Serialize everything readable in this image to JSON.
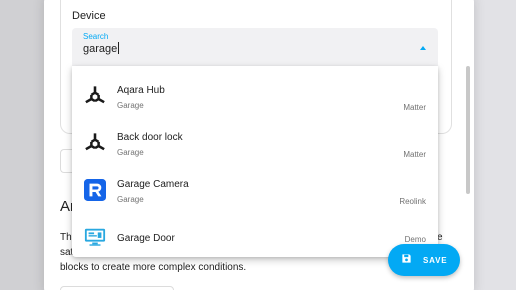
{
  "dialog": {
    "device_label": "Device",
    "search": {
      "label": "Search",
      "value": "garage"
    },
    "area_heading_start": "Ar",
    "area_heading_end": ")",
    "description": {
      "fragment_1": "Th",
      "fragment_2": "sat",
      "end_fragment": "e",
      "line_3": "blocks to create more complex conditions."
    },
    "save_label": "SAVE"
  },
  "menu": {
    "items": [
      {
        "name": "Aqara Hub",
        "area": "Garage",
        "source": "Matter",
        "icon": "matter-icon"
      },
      {
        "name": "Back door lock",
        "area": "Garage",
        "source": "Matter",
        "icon": "matter-icon"
      },
      {
        "name": "Garage Camera",
        "area": "Garage",
        "source": "Reolink",
        "icon": "reolink-icon"
      },
      {
        "name": "Garage Door",
        "area": "",
        "source": "Demo",
        "icon": "monitor-icon"
      }
    ]
  },
  "colors": {
    "accent": "#03a9f4",
    "reolink_blue": "#1565e8",
    "monitor_blue": "#29a8e0"
  }
}
